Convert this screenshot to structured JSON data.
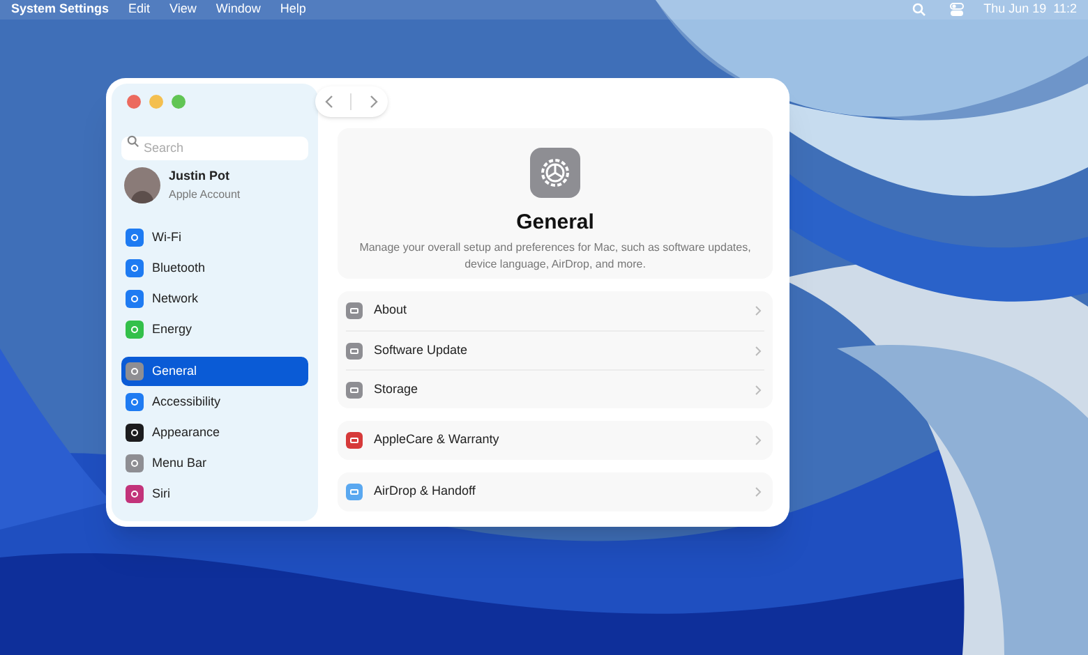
{
  "menu_bar": {
    "app": "System Settings",
    "menus": [
      "Edit",
      "View",
      "Window",
      "Help"
    ],
    "clock": "Thu Jun 19  11:2"
  },
  "window": {
    "search": {
      "placeholder": "Search"
    },
    "account": {
      "name": "Justin Pot",
      "subtitle": "Apple Account"
    },
    "sidebar": {
      "groups": [
        [
          {
            "label": "Wi-Fi",
            "color": "#1e7bf2",
            "selected": false
          },
          {
            "label": "Bluetooth",
            "color": "#1e7bf2",
            "selected": false
          },
          {
            "label": "Network",
            "color": "#1e7bf2",
            "selected": false
          },
          {
            "label": "Energy",
            "color": "#33c04a",
            "selected": false
          }
        ],
        [
          {
            "label": "General",
            "color": "#8e8e93",
            "selected": true
          },
          {
            "label": "Accessibility",
            "color": "#1e7bf2",
            "selected": false
          },
          {
            "label": "Appearance",
            "color": "#1c1c1e",
            "selected": false
          },
          {
            "label": "Menu Bar",
            "color": "#8e8e93",
            "selected": false
          },
          {
            "label": "Siri",
            "color": "#c2337a",
            "selected": false
          }
        ]
      ]
    },
    "header": {
      "title": "General",
      "description": "Manage your overall setup and preferences for Mac, such as software updates, device language, AirDrop, and more."
    },
    "groups": [
      [
        {
          "label": "About",
          "color": "#8e8e93"
        },
        {
          "label": "Software Update",
          "color": "#8e8e93"
        },
        {
          "label": "Storage",
          "color": "#8e8e93"
        }
      ],
      [
        {
          "label": "AppleCare & Warranty",
          "color": "#d63a3a"
        }
      ],
      [
        {
          "label": "AirDrop & Handoff",
          "color": "#5aa8f0"
        }
      ]
    ]
  }
}
